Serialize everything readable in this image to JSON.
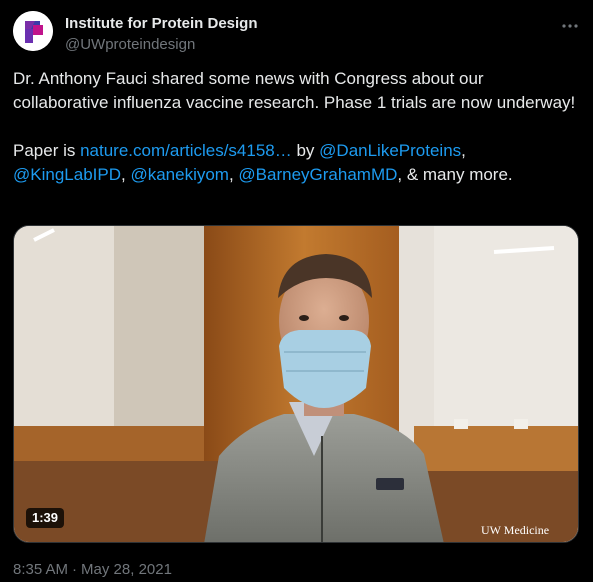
{
  "author": {
    "display_name": "Institute for Protein Design",
    "handle": "@UWproteindesign",
    "avatar_icon": "ipd-logo-icon"
  },
  "more_icon": "more-options-icon",
  "tweet": {
    "line_1": "Dr. Anthony Fauci shared some news with Congress about our collaborative influenza vaccine research. Phase 1 trials are now underway!",
    "paper_prefix": "Paper is ",
    "paper_link": "nature.com/articles/s4158…",
    "by": " by ",
    "mention_1": "@DanLikeProteins",
    "sep_1": ",",
    "mention_2": "@KingLabIPD",
    "sep_2": ", ",
    "mention_3": "@kanekiyom",
    "sep_3": ", ",
    "mention_4": "@BarneyGrahamMD",
    "suffix": ", & many more."
  },
  "video": {
    "duration": "1:39",
    "watermark": "UW Medicine"
  },
  "meta": {
    "time": "8:35 AM",
    "separator": "·",
    "date": "May 28, 2021"
  },
  "colors": {
    "background": "#000000",
    "text_primary": "#e7e9ea",
    "text_secondary": "#71767b",
    "link": "#1d9bf0",
    "border": "#2f3336",
    "brand_magenta": "#c0138b",
    "brand_blue": "#3b3ba8"
  }
}
